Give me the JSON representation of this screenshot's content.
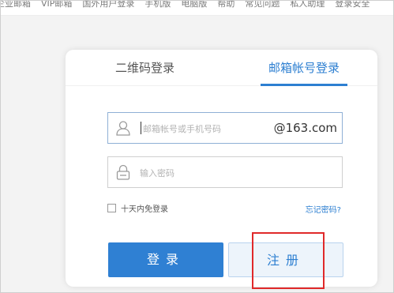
{
  "top_nav": {
    "links": [
      "企业邮箱",
      "VIP邮箱",
      "国外用户登录",
      "手机版",
      "电脑版",
      "帮助",
      "常见问题",
      "私人助理",
      "登录安全"
    ]
  },
  "login": {
    "tabs": {
      "qr": "二维码登录",
      "email": "邮箱帐号登录"
    },
    "active_tab": "email",
    "email_field": {
      "placeholder": "邮箱帐号或手机号码",
      "suffix": "@163.com"
    },
    "password_field": {
      "placeholder": "输入密码"
    },
    "remember_label": "十天内免登录",
    "remember_checked": false,
    "forgot_link": "忘记密码?",
    "login_button": "登录",
    "register_button": "注册"
  },
  "icons": [
    "user-icon",
    "lock-icon"
  ],
  "colors": {
    "accent": "#2d7fd1",
    "highlight": "#e0292a"
  }
}
